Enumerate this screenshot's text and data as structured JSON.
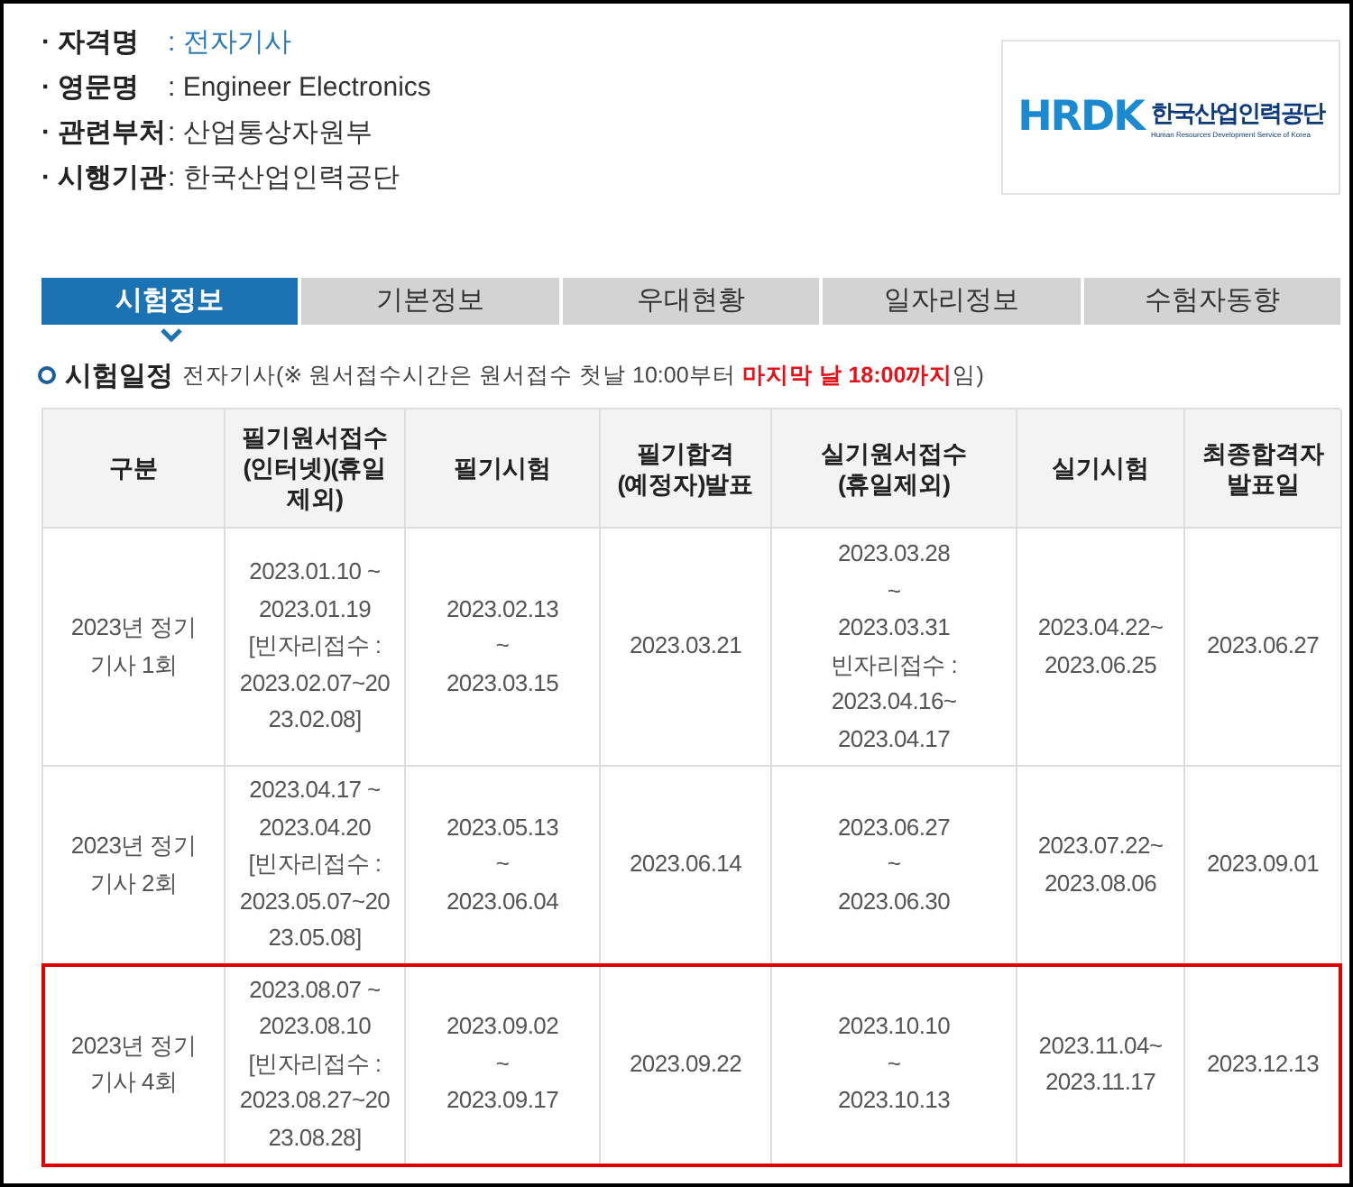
{
  "info": [
    {
      "label": "· 자격명",
      "value": ": 전자기사",
      "link": true
    },
    {
      "label": "· 영문명",
      "value": ": Engineer Electronics",
      "link": false
    },
    {
      "label": "· 관련부처",
      "value": ": 산업통상자원부",
      "link": false
    },
    {
      "label": "· 시행기관",
      "value": ": 한국산업인력공단",
      "link": false
    }
  ],
  "logo": {
    "mark": "HRDK",
    "name": "한국산업인력공단",
    "subtitle": "Human Resources Development Service of Korea"
  },
  "tabs": [
    {
      "label": "시험정보",
      "selected": true
    },
    {
      "label": "기본정보",
      "selected": false
    },
    {
      "label": "우대현황",
      "selected": false
    },
    {
      "label": "일자리정보",
      "selected": false
    },
    {
      "label": "수험자동향",
      "selected": false
    }
  ],
  "section": {
    "title": "시험일정",
    "note": "전자기사(※ 원서접수시간은 원서접수 첫날 10:00부터 **마지막 날 18:00까지**임)"
  },
  "table": {
    "columns": [
      "구분",
      "필기원서접수\n(인터넷)(휴일\n제외)",
      "필기시험",
      "필기합격\n(예정자)발표",
      "실기원서접수\n(휴일제외)",
      "실기시험",
      "최종합격자\n발표일"
    ],
    "rows": [
      {
        "highlighted": false,
        "cells": [
          "2023년 정기\n기사 1회",
          "2023.01.10 ~\n2023.01.19\n[빈자리접수 :\n2023.02.07~20\n23.02.08]",
          "2023.02.13\n~\n2023.03.15",
          "2023.03.21",
          "2023.03.28\n~\n2023.03.31\n빈자리접수 :\n2023.04.16~\n2023.04.17",
          "2023.04.22~\n2023.06.25",
          "2023.06.27"
        ]
      },
      {
        "highlighted": false,
        "cells": [
          "2023년 정기\n기사 2회",
          "2023.04.17 ~\n2023.04.20\n[빈자리접수 :\n2023.05.07~20\n23.05.08]",
          "2023.05.13\n~\n2023.06.04",
          "2023.06.14",
          "2023.06.27\n~\n2023.06.30",
          "2023.07.22~\n2023.08.06",
          "2023.09.01"
        ]
      },
      {
        "highlighted": true,
        "cells": [
          "2023년 정기\n기사 4회",
          "2023.08.07 ~\n2023.08.10\n[빈자리접수 :\n2023.08.27~20\n23.08.28]",
          "2023.09.02\n~\n2023.09.17",
          "2023.09.22",
          "2023.10.10\n~\n2023.10.13",
          "2023.11.04~\n2023.11.17",
          "2023.12.13"
        ]
      }
    ]
  }
}
